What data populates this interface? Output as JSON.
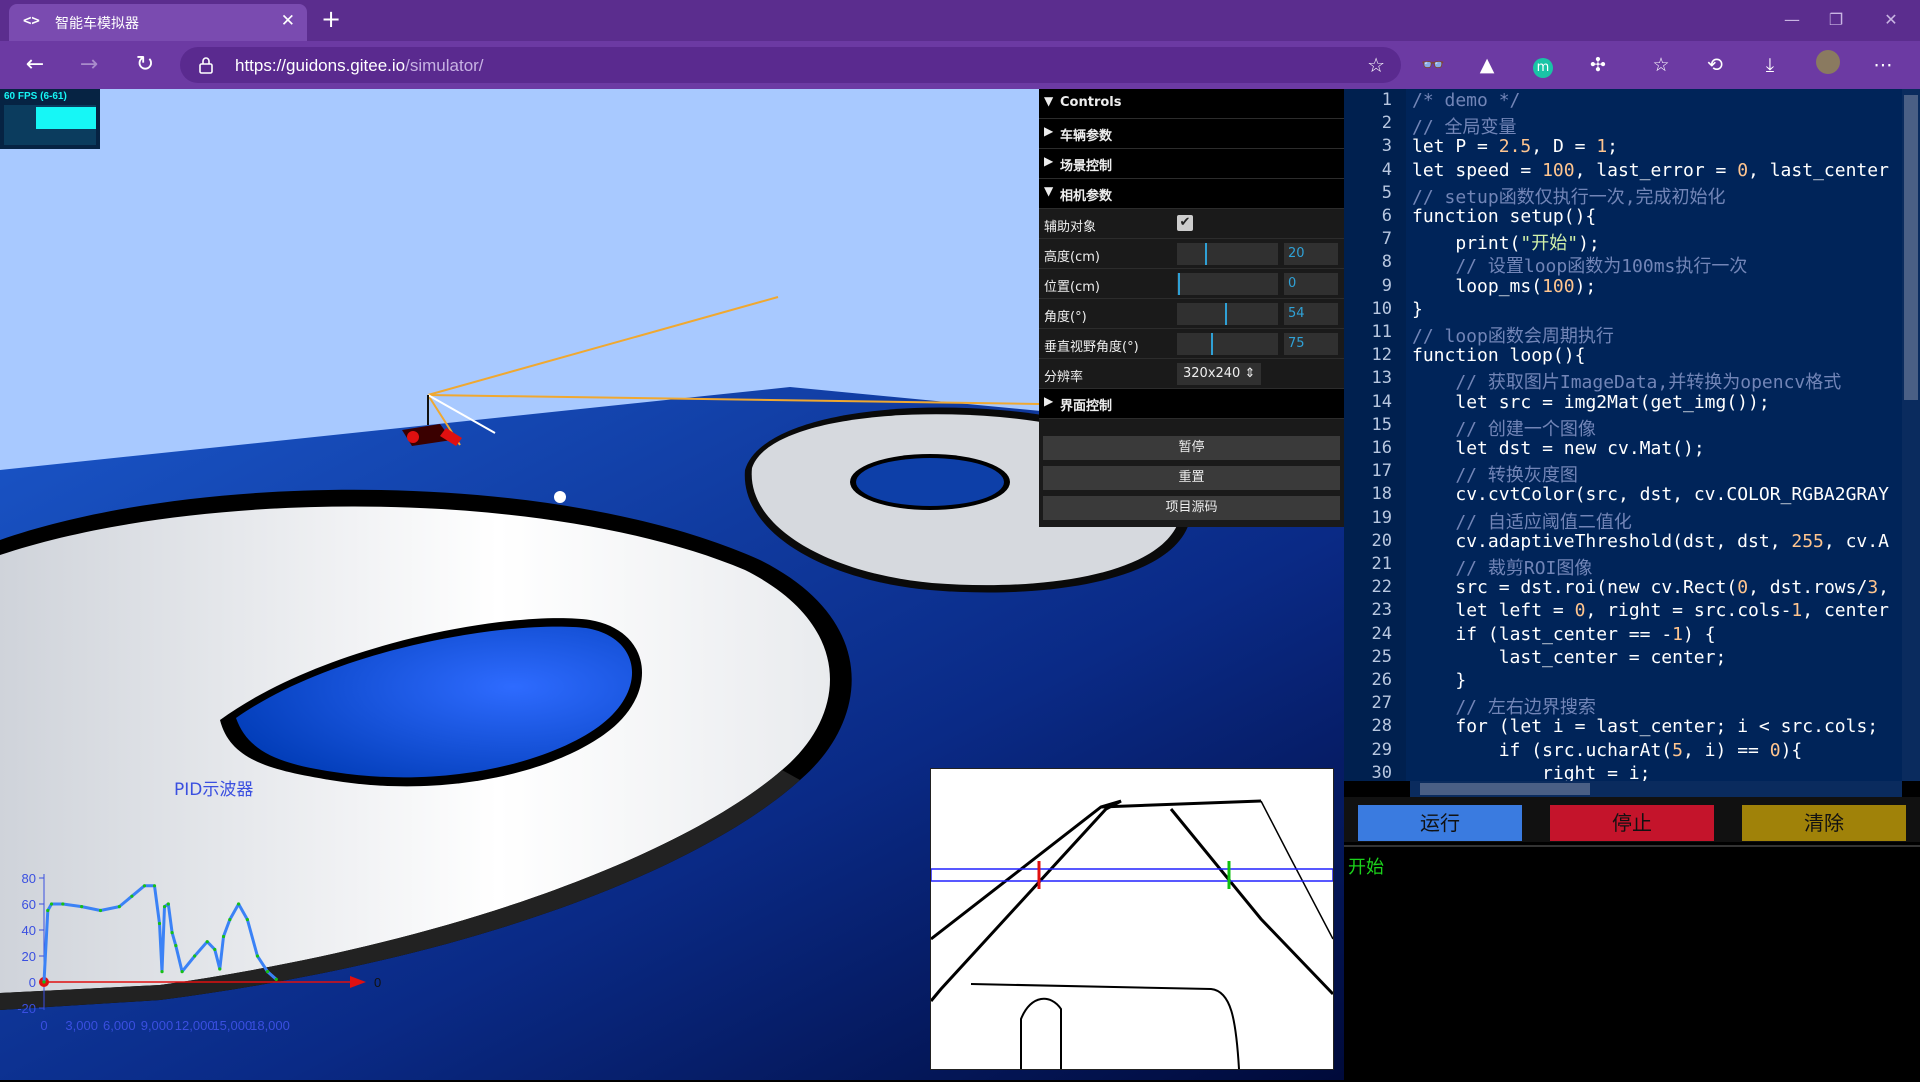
{
  "browser": {
    "tab_title": "智能车模拟器",
    "tab_icon": "code-icon",
    "url_host": "https://guidons.gitee.io",
    "url_path": "/simulator/"
  },
  "fps": {
    "label": "60 FPS (6-61)"
  },
  "controls": {
    "header": "Controls",
    "folders": [
      "车辆参数",
      "场景控制",
      "相机参数",
      "界面控制"
    ],
    "params": [
      {
        "label": "辅助对象",
        "checked": true
      },
      {
        "label": "高度(cm)",
        "value": "20",
        "fraction": 0.28
      },
      {
        "label": "位置(cm)",
        "value": "0",
        "fraction": 0.0
      },
      {
        "label": "角度(°)",
        "value": "54",
        "fraction": 0.48
      },
      {
        "label": "垂直视野角度(°)",
        "value": "75",
        "fraction": 0.34
      },
      {
        "label": "分辨率",
        "value": "320x240 ⇕"
      }
    ],
    "buttons": [
      "暂停",
      "重置",
      "项目源码"
    ]
  },
  "editor": {
    "lines": [
      "/* demo */",
      "// 全局变量",
      "let P = 2.5, D = 1;",
      "let speed = 100, last_error = 0, last_center",
      "// setup函数仅执行一次,完成初始化",
      "function setup(){",
      "    print(\"开始\");",
      "    // 设置loop函数为100ms执行一次",
      "    loop_ms(100);",
      "}",
      "// loop函数会周期执行",
      "function loop(){",
      "    // 获取图片ImageData,并转换为opencv格式",
      "    let src = img2Mat(get_img());",
      "    // 创建一个图像",
      "    let dst = new cv.Mat();",
      "    // 转换灰度图",
      "    cv.cvtColor(src, dst, cv.COLOR_RGBA2GRAY",
      "    // 自适应阈值二值化",
      "    cv.adaptiveThreshold(dst, dst, 255, cv.A",
      "    // 裁剪ROI图像",
      "    src = dst.roi(new cv.Rect(0, dst.rows/3,",
      "    let left = 0, right = src.cols-1, center",
      "    if (last_center == -1) {",
      "        last_center = center;",
      "    }",
      "    // 左右边界搜索",
      "    for (let i = last_center; i < src.cols;",
      "        if (src.ucharAt(5, i) == 0){",
      "            right = i;",
      "            break;"
    ]
  },
  "run_buttons": [
    {
      "label": "运行",
      "color": "#3a7be0"
    },
    {
      "label": "停止",
      "color": "#c4142b"
    },
    {
      "label": "清除",
      "color": "#a08209"
    }
  ],
  "console": {
    "output": "开始"
  },
  "scope": {
    "title": "PID示波器",
    "end_marker": "0"
  },
  "chart_data": {
    "type": "line",
    "title": "PID示波器",
    "x_ticks": [
      "0",
      "3,000",
      "6,000",
      "9,000",
      "12,000",
      "15,000",
      "18,000"
    ],
    "y_ticks": [
      "80",
      "60",
      "40",
      "20",
      "0",
      "-20"
    ],
    "ylim": [
      -20,
      80
    ],
    "xlim": [
      0,
      18000
    ],
    "series": [
      {
        "color": "#3b82f6",
        "x": [
          0,
          300,
          600,
          1500,
          3000,
          4500,
          6000,
          7000,
          8000,
          8800,
          9200,
          9400,
          9600,
          9900,
          10200,
          10500,
          11000,
          12000,
          13000,
          13600,
          14000,
          14300,
          14800,
          15500,
          16200,
          17000,
          17800,
          18500
        ],
        "y": [
          0,
          55,
          60,
          60,
          58,
          55,
          58,
          66,
          74,
          74,
          45,
          8,
          58,
          60,
          38,
          28,
          8,
          20,
          31,
          25,
          10,
          35,
          48,
          60,
          48,
          20,
          8,
          2
        ]
      }
    ]
  }
}
